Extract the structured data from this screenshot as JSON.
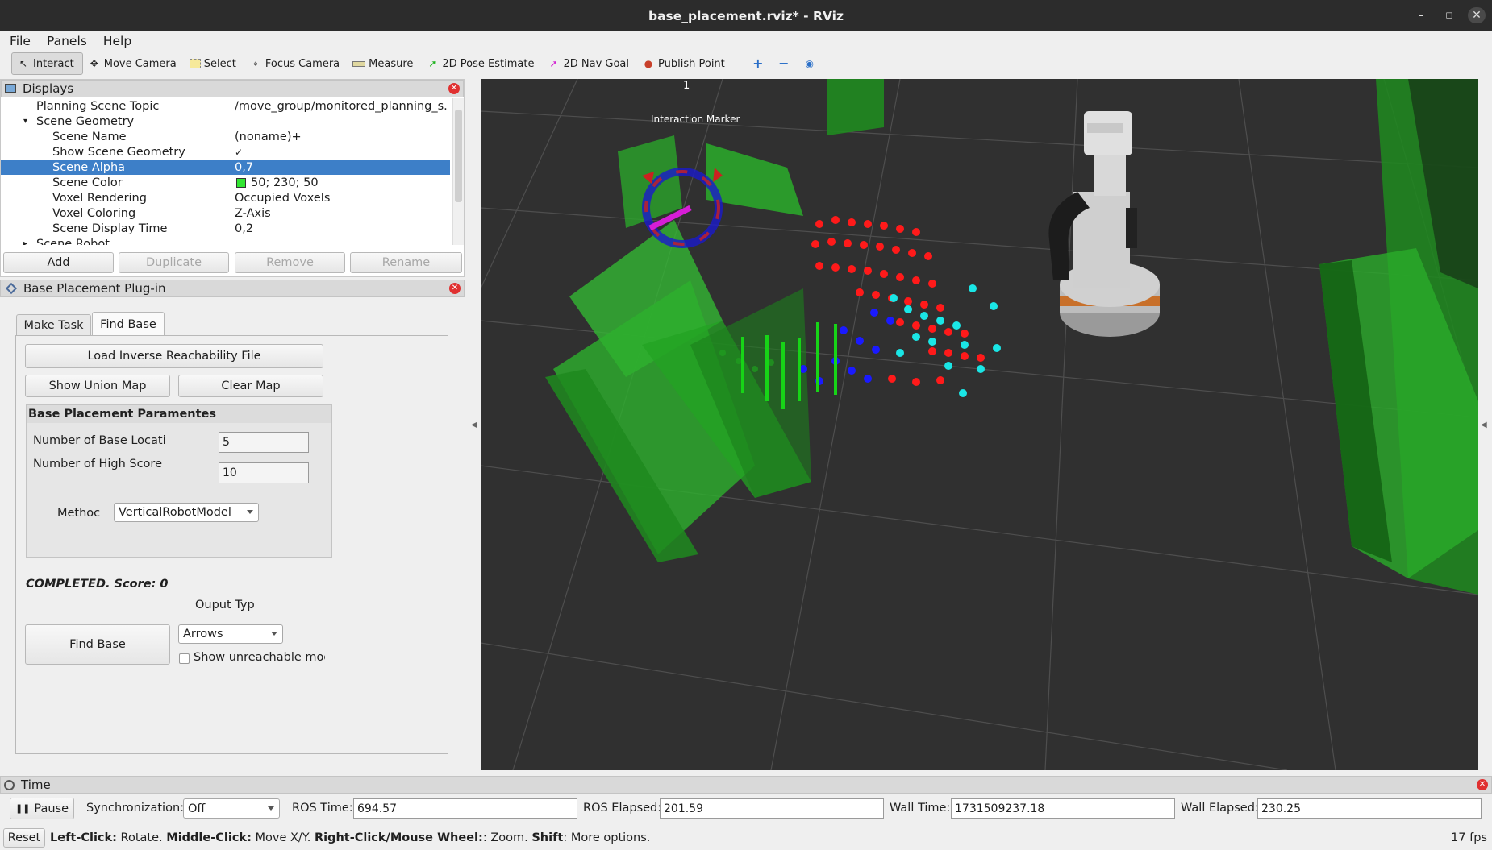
{
  "window": {
    "title": "base_placement.rviz* - RViz"
  },
  "menu": [
    "File",
    "Panels",
    "Help"
  ],
  "toolbar": {
    "tools": [
      "Interact",
      "Move Camera",
      "Select",
      "Focus Camera",
      "Measure",
      "2D Pose Estimate",
      "2D Nav Goal",
      "Publish Point"
    ],
    "icons": [
      "cursor-icon",
      "move-camera-icon",
      "select-icon",
      "focus-camera-icon",
      "measure-icon",
      "pose-estimate-icon",
      "nav-goal-icon",
      "publish-point-icon"
    ]
  },
  "displays": {
    "title": "Displays",
    "rows": [
      {
        "key": "Planning Scene Topic",
        "value": "/move_group/monitored_planning_s..."
      },
      {
        "key": "Scene Geometry",
        "value": ""
      },
      {
        "key": "Scene Name",
        "value": "(noname)+"
      },
      {
        "key": "Show Scene Geometry",
        "value": "✓"
      },
      {
        "key": "Scene Alpha",
        "value": "0,7"
      },
      {
        "key": "Scene Color",
        "value": "50; 230; 50"
      },
      {
        "key": "Voxel Rendering",
        "value": "Occupied Voxels"
      },
      {
        "key": "Voxel Coloring",
        "value": "Z-Axis"
      },
      {
        "key": "Scene Display Time",
        "value": "0,2"
      },
      {
        "key": "Scene Robot",
        "value": ""
      }
    ],
    "buttons": [
      "Add",
      "Duplicate",
      "Remove",
      "Rename"
    ]
  },
  "plugin": {
    "title": "Base Placement Plug-in",
    "tabs": [
      "Make Task",
      "Find Base"
    ],
    "load_button": "Load Inverse Reachability File",
    "union_button": "Show Union Map",
    "clear_button": "Clear Map",
    "params_title": "Base Placement Paramentes",
    "num_base_label": "Number of Base Locatio",
    "num_base_value": "5",
    "num_high_label": "Number of High Score Spher",
    "num_high_value": "10",
    "method_label": "Methoc",
    "method_value": "VerticalRobotModel",
    "status": "COMPLETED. Score: 0",
    "output_label": "Ouput Typ",
    "find_button": "Find Base",
    "output_value": "Arrows",
    "unreachable_label": "Show unreachable mode"
  },
  "viewport": {
    "marker_number": "1",
    "marker_label": "Interaction  Marker"
  },
  "time": {
    "title": "Time",
    "pause": "Pause",
    "sync_label": "Synchronization:",
    "sync_value": "Off",
    "ros_time_label": "ROS Time:",
    "ros_time": "694.57",
    "ros_elapsed_label": "ROS Elapsed:",
    "ros_elapsed": "201.59",
    "wall_time_label": "Wall Time:",
    "wall_time": "1731509237.18",
    "wall_elapsed_label": "Wall Elapsed:",
    "wall_elapsed": "230.25"
  },
  "statusbar": {
    "reset": "Reset",
    "left_click": "Left-Click:",
    "left_desc": " Rotate. ",
    "middle_click": "Middle-Click:",
    "middle_desc": " Move X/Y. ",
    "right_click": "Right-Click/Mouse Wheel:",
    "right_desc": ": Zoom. ",
    "shift": "Shift",
    "shift_desc": ": More options.",
    "fps": "17 fps"
  },
  "colors": {
    "selection": "#3d7fc8",
    "scene_color": "#32e632",
    "viewport_bg": "#303030"
  }
}
